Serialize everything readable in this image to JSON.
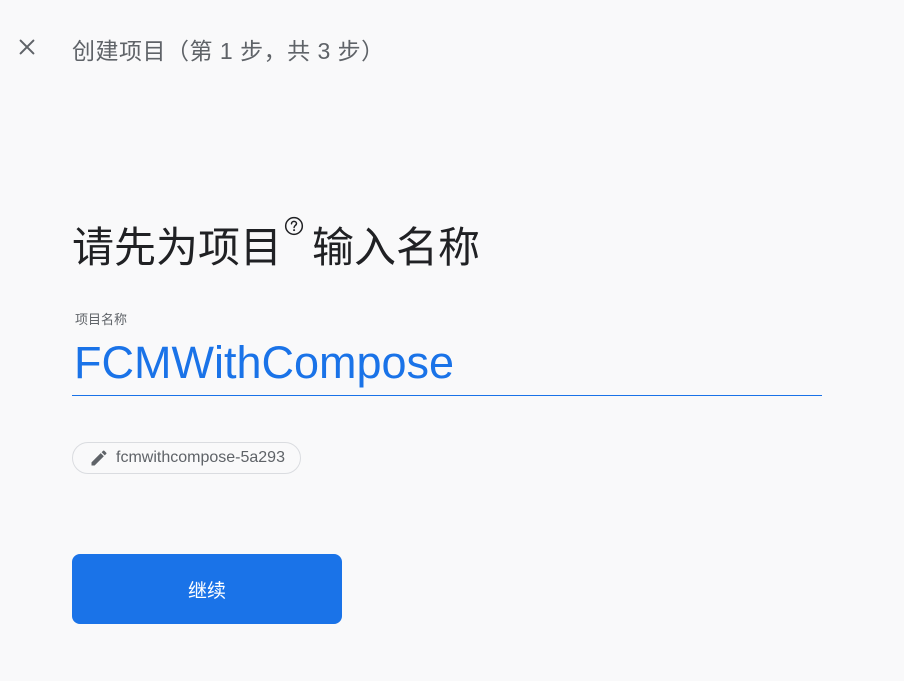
{
  "header": {
    "close_icon": "close-icon",
    "step_title": "创建项目（第 1 步，共 3 步）"
  },
  "main": {
    "heading_part1": "请先为项目",
    "help_icon": "help-circle-icon",
    "heading_part2": "输入名称",
    "project_name_label": "项目名称",
    "project_name_value": "FCMWithCompose",
    "project_id_icon": "pencil-icon",
    "project_id": "fcmwithcompose-5a293",
    "continue_label": "继续"
  },
  "colors": {
    "accent": "#1a73e8",
    "background": "#f9f9fa",
    "text_primary": "#202124",
    "text_secondary": "#5f6368"
  }
}
